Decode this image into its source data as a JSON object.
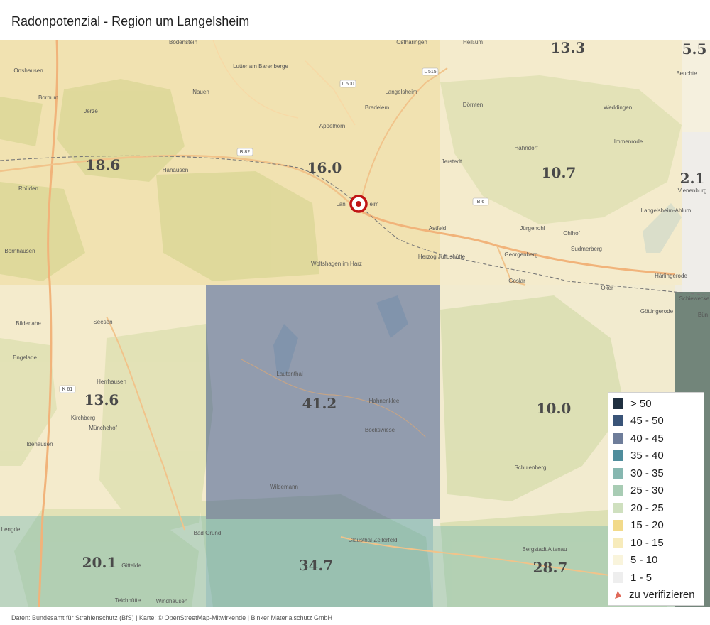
{
  "title": "Radonpotenzial - Region um Langelsheim",
  "footer": "Daten: Bundesamt für Strahlenschutz (BfS)  |  Karte: © OpenStreetMap-Mitwirkende  |  Binker Materialschutz GmbH",
  "legend": {
    "items": [
      {
        "label": "> 50",
        "color": "#1f2f40"
      },
      {
        "label": "45 - 50",
        "color": "#3a5478"
      },
      {
        "label": "40 - 45",
        "color": "#6e7d9a"
      },
      {
        "label": "35 - 40",
        "color": "#4f8d9c"
      },
      {
        "label": "30 - 35",
        "color": "#86b7b0"
      },
      {
        "label": "25 - 30",
        "color": "#a8ccb4"
      },
      {
        "label": "20 - 25",
        "color": "#cfe0bf"
      },
      {
        "label": "15 - 20",
        "color": "#f2da8a"
      },
      {
        "label": "10 - 15",
        "color": "#f7ebbb"
      },
      {
        "label": "5 - 10",
        "color": "#f9f4dc"
      },
      {
        "label": "1 - 5",
        "color": "#eeeeee"
      }
    ],
    "verify_label": "zu verifizieren",
    "verify_icon": "triangle-marker-icon",
    "verify_color": "#e06a5a"
  },
  "marker": {
    "icon": "target-marker-icon",
    "color": "#c01515"
  },
  "cells": [
    {
      "value": "18.6",
      "class": "15 - 20"
    },
    {
      "value": "16.0",
      "class": "15 - 20"
    },
    {
      "value": "13.3",
      "class": "10 - 15"
    },
    {
      "value": "10.7",
      "class": "10 - 15"
    },
    {
      "value": "5.5",
      "class": "5 - 10"
    },
    {
      "value": "2.1",
      "class": "1 - 5"
    },
    {
      "value": "13.6",
      "class": "10 - 15"
    },
    {
      "value": "41.2",
      "class": "40 - 45"
    },
    {
      "value": "10.0",
      "class": "10 - 15"
    },
    {
      "value": "20.1",
      "class": "20 - 25"
    },
    {
      "value": "34.7",
      "class": "30 - 35"
    },
    {
      "value": "28.7",
      "class": "25 - 30"
    }
  ],
  "places": [
    "Bodenstein",
    "Ostharingen",
    "Heißum",
    "Beuchte",
    "Lutter am Barenberge",
    "Ortshausen",
    "Bornum",
    "Nauen",
    "Langelsheim",
    "Bredelem",
    "Dörnten",
    "Weddingen",
    "Jerze",
    "Appelhorn",
    "Immenrode",
    "Hahndorf",
    "Hahausen",
    "Jerstedt",
    "Rhüden",
    "Lan",
    "eim",
    "Astfeld",
    "Jürgenohl",
    "Ohlhof",
    "Bornhausen",
    "Georgenberg",
    "Sudmerberg",
    "Wolfshagen im Harz",
    "Herzog Juliushütte",
    "Goslar",
    "Oker",
    "Härlingerode",
    "Seesen",
    "Bilderlahe",
    "Göttingerode",
    "Lautenthal",
    "Engelade",
    "Herrhausen",
    "Hahnenklee",
    "Bockswiese",
    "Kirchberg",
    "Ildehausen",
    "Münchehof",
    "Schulenberg",
    "Wildemann",
    "Bad Grund",
    "Clausthal-Zellerfeld",
    "Bergstadt Altenau",
    "Gittelde",
    "Teichhütte",
    "Windhausen",
    "Schiewecke",
    "Bün",
    "Lengde",
    "Vienenburg",
    "Langelsheim-Ahlum"
  ],
  "roads": [
    "L 500",
    "L 515",
    "B 82",
    "B 6",
    "K 61"
  ]
}
